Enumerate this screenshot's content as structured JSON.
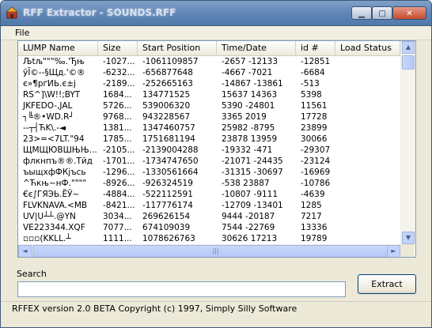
{
  "window": {
    "title": "RFF Extractor - SOUNDS.RFF"
  },
  "titlebar_buttons": {
    "minimize": "▁",
    "maximize": "□",
    "close": "✕"
  },
  "menu": {
    "file": "File"
  },
  "list": {
    "columns": [
      "LUMP Name",
      "Size",
      "Start Position",
      "Time/Date",
      "id #",
      "Load Status"
    ],
    "rows": [
      [
        "Љtљ\"\"\"‰.'Ђњ",
        "-1027...",
        "-1061109857",
        "-2657 -12133",
        "-12851",
        ""
      ],
      [
        "ўЇ©--§Щд.'©®",
        "-6232...",
        "-656877648",
        "-4667 -7021",
        "-6684",
        ""
      ],
      [
        "є»¶рґИЬ.є±j",
        "-2189...",
        "-252665163",
        "-14867 -13861",
        "-513",
        ""
      ],
      [
        "RS^]\\W!!;BYT",
        "1684...",
        "134771525",
        "15637 14363",
        "5398",
        ""
      ],
      [
        "JKFEDO-,JAL",
        "5726...",
        "539006320",
        "5390 -24801",
        "11561",
        ""
      ],
      [
        "┐╚®•WD.R┘",
        "9768...",
        "943228567",
        "3365 2019",
        "17728",
        ""
      ],
      [
        "--┬┤ЋK\\.-◄",
        "1381...",
        "1347460757",
        "25982 -8795",
        "23899",
        ""
      ],
      [
        "23>=<7LT.\"94",
        "1785...",
        "1751681194",
        "23878 13959",
        "30066",
        ""
      ],
      [
        "ЩМЩЮВШЊЊ...",
        "-2105...",
        "-2139004288",
        "-19332 -471",
        "-29307",
        ""
      ],
      [
        "флкнпъ®®.Тйд",
        "-1701...",
        "-1734747650",
        "-21071 -24435",
        "-23124",
        ""
      ],
      [
        "ъыщхфФКјъсь",
        "-1296...",
        "-1330561664",
        "-31315 -30697",
        "-16969",
        ""
      ],
      [
        "^Ћкњ~нФ.\"\"\"\"",
        "-8926...",
        "-926324519",
        "-538 23887",
        "-10786",
        ""
      ],
      [
        "€є∫ГЯЭЬ.ЁЎ~",
        "-4884...",
        "-522112591",
        "-10807 -9111",
        "-4639",
        ""
      ],
      [
        "FLVKNAVA.<MB",
        "-8421...",
        "-117776174",
        "-12709 -13401",
        "1285",
        ""
      ],
      [
        "UV|U┴┴.@YN",
        "3034...",
        "269626154",
        "9444 -20187",
        "7217",
        ""
      ],
      [
        "VE223344.XQF",
        "7077...",
        "674109039",
        "7544 -22769",
        "13336",
        ""
      ],
      [
        "▫▫▫(KKLL.┴",
        "1111...",
        "1078626763",
        "30626 17213",
        "19789",
        ""
      ]
    ]
  },
  "search": {
    "label": "Search",
    "value": ""
  },
  "extract_button": {
    "label": "Extract"
  },
  "status": {
    "text": "RFFEX version 2.0 BETA Copyright (c) 1997, Simply Silly Software"
  },
  "scroll": {
    "up": "▲",
    "down": "▼",
    "left": "◄",
    "right": "►",
    "grip": "|||"
  },
  "colors": {
    "titlebar": "#5f84b4",
    "list_border": "#7f9db9",
    "button_border": "#003c74"
  }
}
